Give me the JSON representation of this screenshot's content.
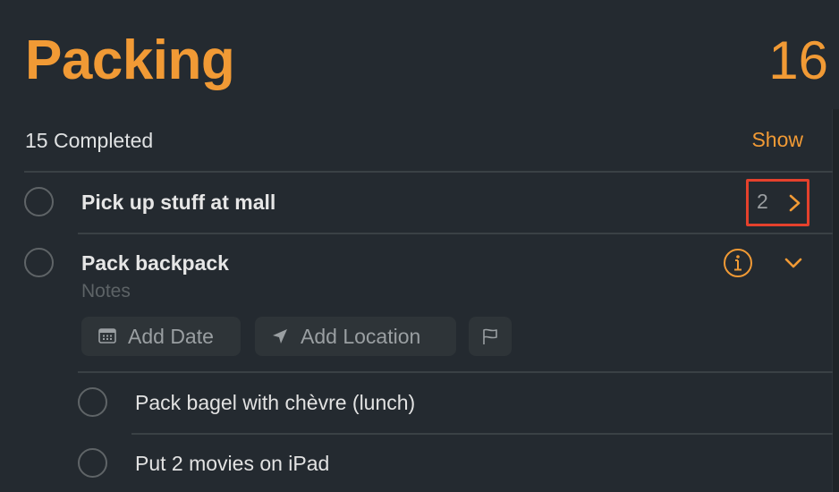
{
  "header": {
    "title": "Packing",
    "count": "16"
  },
  "completed": {
    "label": "15 Completed",
    "show_label": "Show"
  },
  "tasks": [
    {
      "title": "Pick up stuff at mall",
      "subtask_count": "2",
      "icon": "chevron-right-icon"
    },
    {
      "title": "Pack backpack",
      "notes_placeholder": "Notes",
      "actions": {
        "add_date": "Add Date",
        "add_location": "Add Location",
        "flag_icon": "flag-icon",
        "info_icon": "info-icon",
        "collapse_icon": "chevron-down-icon"
      },
      "subtasks": [
        {
          "title": "Pack bagel with chèvre (lunch)"
        },
        {
          "title": "Put 2 movies on iPad"
        }
      ]
    }
  ],
  "colors": {
    "accent": "#f19a35",
    "background": "#242a30",
    "highlight_box": "#e5412c",
    "pill_bg": "#2e3438",
    "muted_text": "#5d6366"
  }
}
